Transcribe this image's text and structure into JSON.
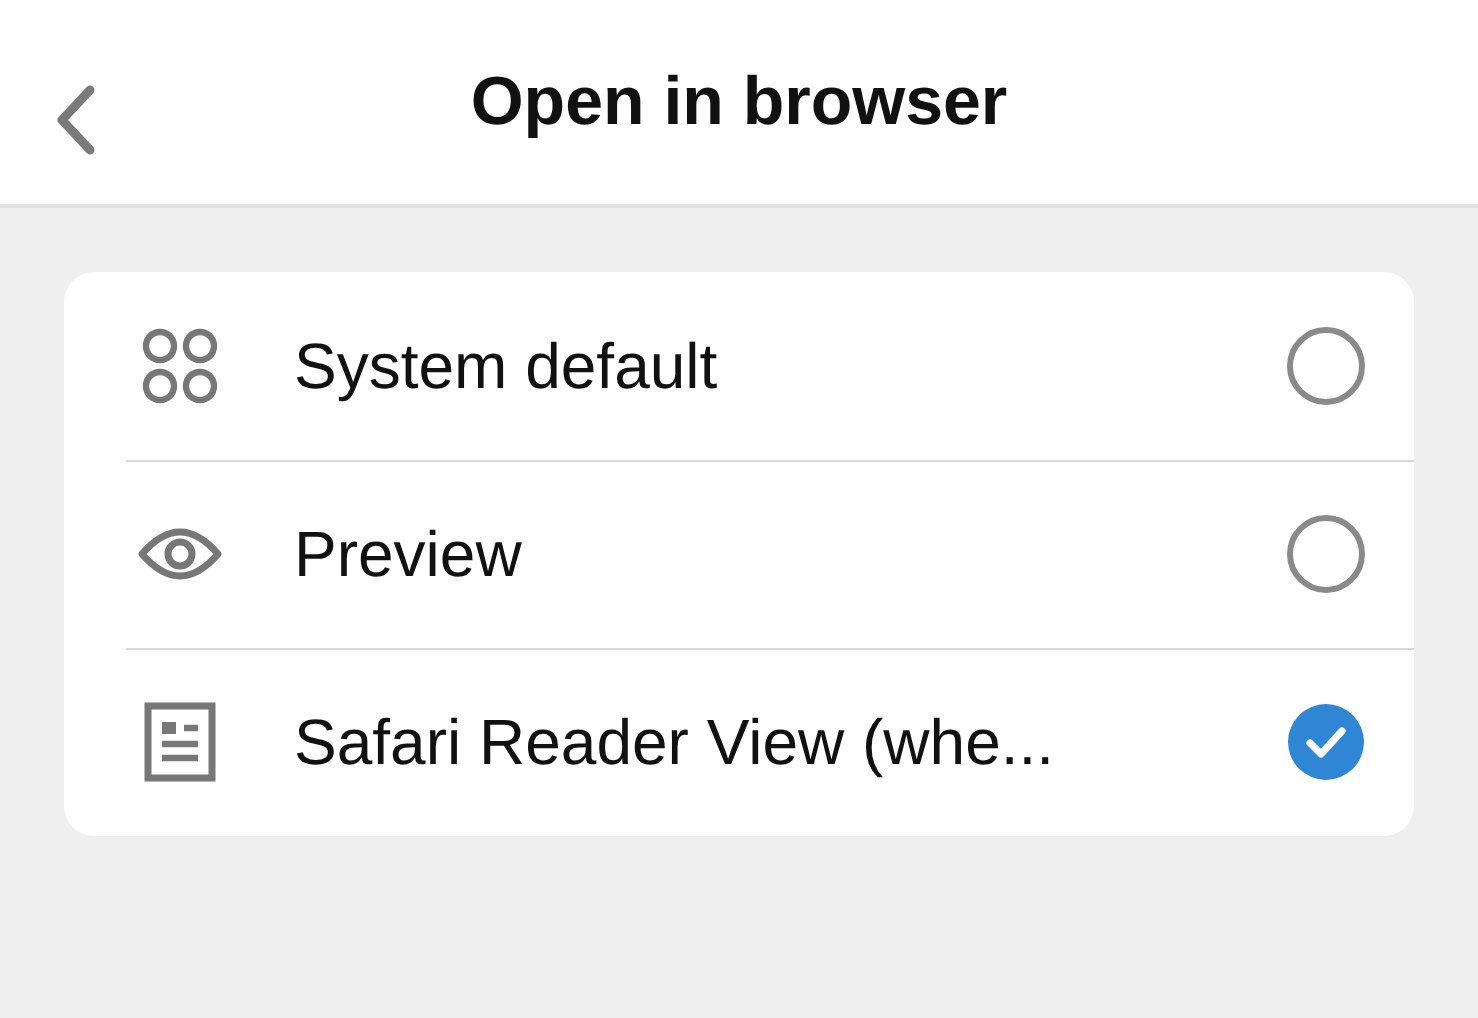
{
  "header": {
    "title": "Open in browser"
  },
  "options": [
    {
      "kind": "grid",
      "label": "System default",
      "selected": false
    },
    {
      "kind": "eye",
      "label": "Preview",
      "selected": false
    },
    {
      "kind": "article",
      "label": "Safari Reader View (whe...",
      "selected": true
    }
  ]
}
